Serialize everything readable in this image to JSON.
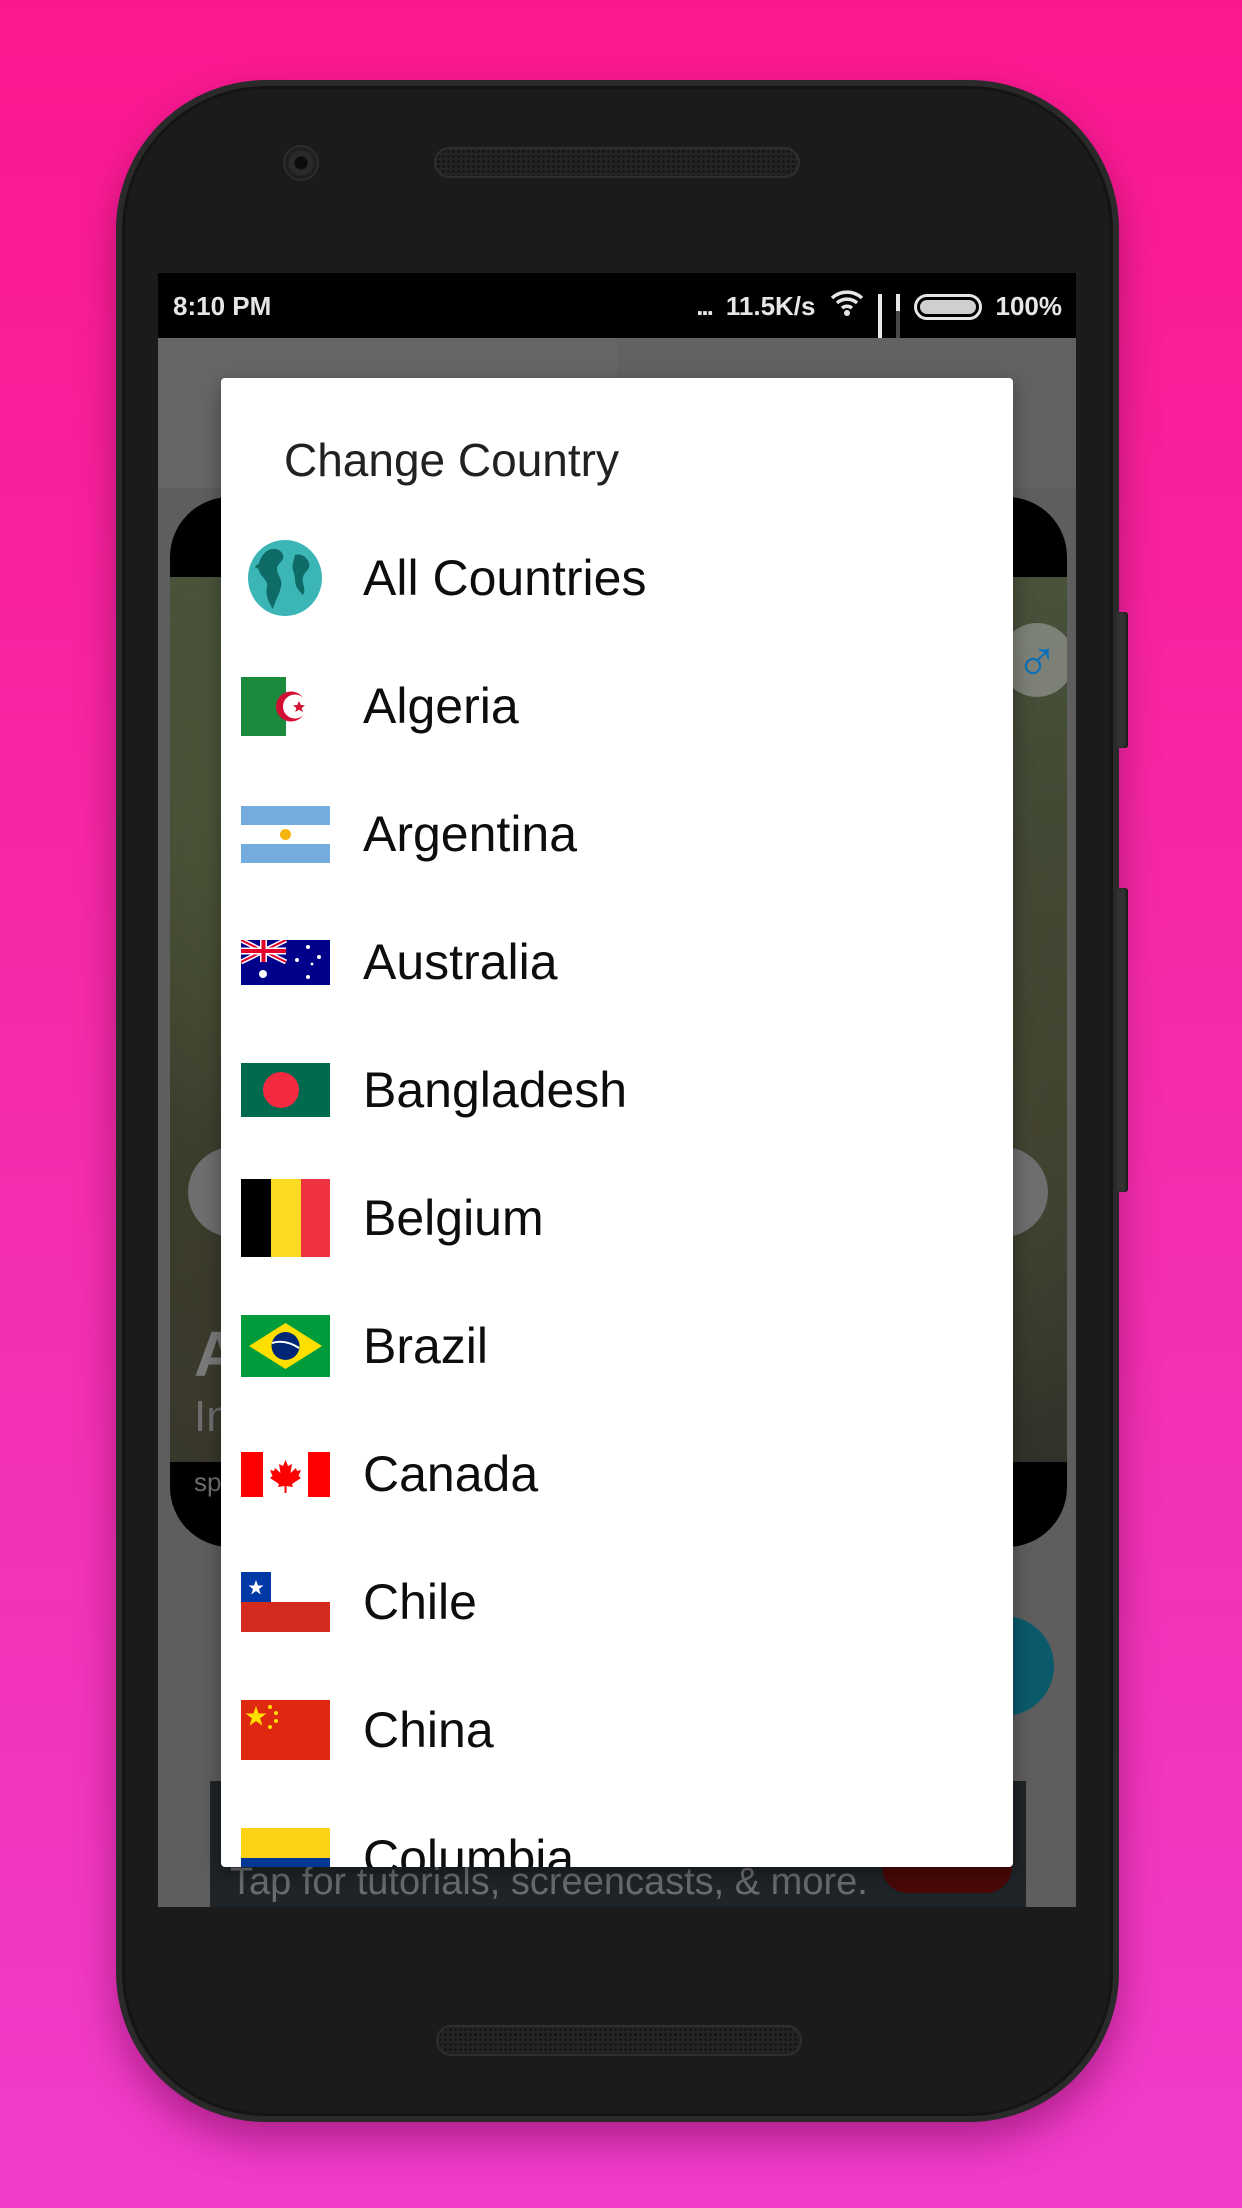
{
  "status_bar": {
    "time": "8:10 PM",
    "dots": "...",
    "net_speed": "11.5K/s",
    "wifi_icon": "wifi-icon",
    "signal_icon_1": "signal-strong-icon",
    "signal_icon_2": "signal-weak-icon",
    "battery_icon": "battery-full-icon",
    "battery_percent": "100%"
  },
  "background_app": {
    "gender_icon": "♂",
    "gender_color": "#0a6fb8",
    "card_title_fragment": "A",
    "card_subtitle_fragment": "In",
    "card_small_fragment": "sp",
    "banner_text": "Tap for tutorials, screencasts, & more.",
    "fab_color": "#0b5a6c",
    "banner_button_color": "#4a0808"
  },
  "dialog": {
    "title": "Change Country",
    "items": [
      {
        "label": "All Countries",
        "icon": "globe-icon"
      },
      {
        "label": "Algeria",
        "icon": "flag-algeria-icon"
      },
      {
        "label": "Argentina",
        "icon": "flag-argentina-icon"
      },
      {
        "label": "Australia",
        "icon": "flag-australia-icon"
      },
      {
        "label": "Bangladesh",
        "icon": "flag-bangladesh-icon"
      },
      {
        "label": "Belgium",
        "icon": "flag-belgium-icon"
      },
      {
        "label": "Brazil",
        "icon": "flag-brazil-icon"
      },
      {
        "label": "Canada",
        "icon": "flag-canada-icon"
      },
      {
        "label": "Chile",
        "icon": "flag-chile-icon"
      },
      {
        "label": "China",
        "icon": "flag-china-icon"
      },
      {
        "label": "Columbia",
        "icon": "flag-colombia-icon"
      }
    ]
  },
  "colors": {
    "background_top": "#fc1790",
    "background_bottom": "#ef3ccb",
    "dialog_bg": "#ffffff",
    "globe": "#3bb5b5"
  }
}
